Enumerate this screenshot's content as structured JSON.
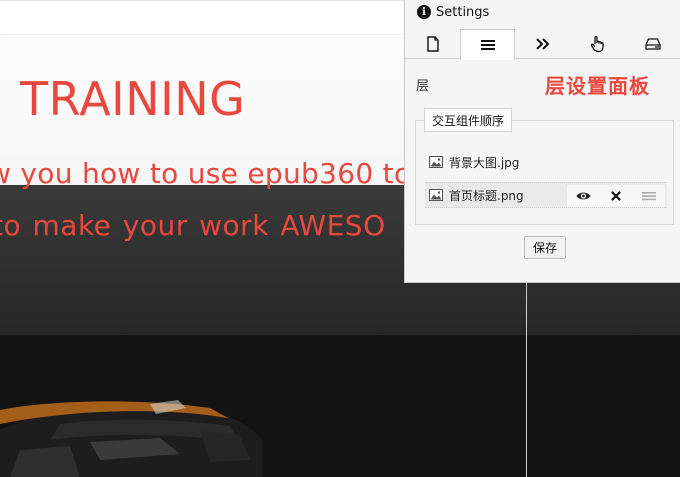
{
  "canvas": {
    "title": "TRAINING",
    "subtitle_line1": "w you how to use epub360 to",
    "subtitle_line2": "to make your work  AWESO",
    "accent_color": "#e8483d"
  },
  "panel": {
    "title": "Settings",
    "title_icon": "info-icon",
    "tabs": [
      {
        "icon": "page-icon",
        "active": false
      },
      {
        "icon": "layers-list-icon",
        "active": true
      },
      {
        "icon": "double-chevron-right-icon",
        "active": false
      },
      {
        "icon": "hand-pointer-icon",
        "active": false
      },
      {
        "icon": "drive-icon",
        "active": false
      }
    ],
    "section_label": "层",
    "heading": "层设置面板",
    "group_title": "交互组件顺序",
    "layers": [
      {
        "name": "背景大图.jpg",
        "icon": "image-icon"
      },
      {
        "name": "首页标题.png",
        "icon": "image-icon",
        "tools": [
          "eye-icon",
          "close-icon",
          "drag-handle-icon"
        ]
      }
    ],
    "save_label": "保存"
  }
}
